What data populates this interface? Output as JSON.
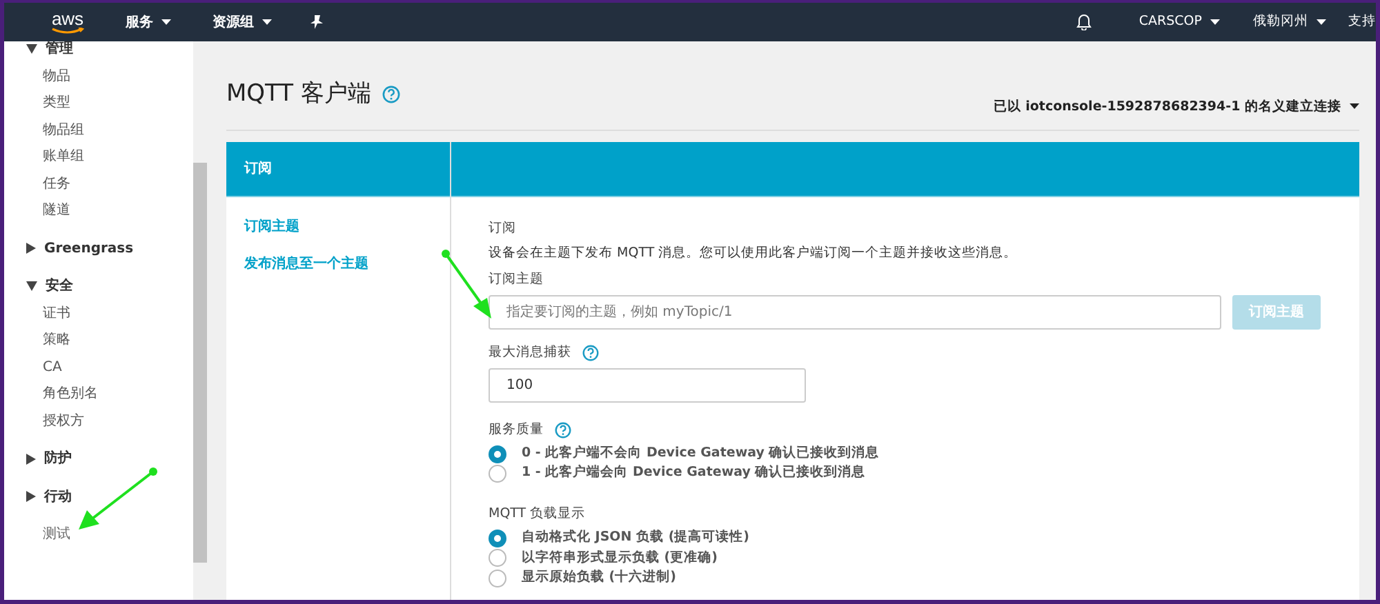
{
  "navbar": {
    "logo": "aws",
    "menus": [
      {
        "label": "服务",
        "dropdown": true
      },
      {
        "label": "资源组",
        "dropdown": true
      }
    ],
    "right_menus": [
      {
        "label": "CARSCOP",
        "dropdown": true
      },
      {
        "label": "俄勒冈州",
        "dropdown": true
      },
      {
        "label": "支持",
        "dropdown": false
      }
    ]
  },
  "sidebar": {
    "items": [
      {
        "kind": "group",
        "label": "管理",
        "expanded": true,
        "children": [
          {
            "label": "物品"
          },
          {
            "label": "类型"
          },
          {
            "label": "物品组"
          },
          {
            "label": "账单组"
          },
          {
            "label": "任务"
          },
          {
            "label": "隧道"
          }
        ]
      },
      {
        "kind": "group",
        "label": "Greengrass",
        "expanded": false
      },
      {
        "kind": "group",
        "label": "安全",
        "expanded": true,
        "children": [
          {
            "label": "证书"
          },
          {
            "label": "策略"
          },
          {
            "label": "CA"
          },
          {
            "label": "角色别名"
          },
          {
            "label": "授权方"
          }
        ]
      },
      {
        "kind": "group",
        "label": "防护",
        "expanded": false
      },
      {
        "kind": "group",
        "label": "行动",
        "expanded": false
      },
      {
        "kind": "link",
        "label": "测试"
      }
    ]
  },
  "page": {
    "title": "MQTT 客户端",
    "connection": "已以 iotconsole-1592878682394-1 的名义建立连接"
  },
  "panel": {
    "tab": "订阅",
    "links": [
      {
        "label": "订阅主题"
      },
      {
        "label": "发布消息至一个主题"
      }
    ],
    "section_title": "订阅",
    "description": "设备会在主题下发布 MQTT 消息。您可以使用此客户端订阅一个主题并接收这些消息。",
    "topic_label": "订阅主题",
    "topic_placeholder": "指定要订阅的主题，例如 myTopic/1",
    "subscribe_button": {
      "label": "订阅主题",
      "disabled": true
    },
    "max_label": "最大消息捕获",
    "max_value": "100",
    "qos_label": "服务质量",
    "qos_options": [
      {
        "label": "0 - 此客户端不会向 Device Gateway 确认已接收到消息",
        "selected": true
      },
      {
        "label": "1 - 此客户端会向 Device Gateway 确认已接收到消息",
        "selected": false
      }
    ],
    "payload_label": "MQTT 负载显示",
    "payload_options": [
      {
        "label": "自动格式化 JSON 负载 (提高可读性)",
        "selected": true
      },
      {
        "label": "以字符串形式显示负载 (更准确)",
        "selected": false
      },
      {
        "label": "显示原始负载 (十六进制)",
        "selected": false
      }
    ]
  }
}
